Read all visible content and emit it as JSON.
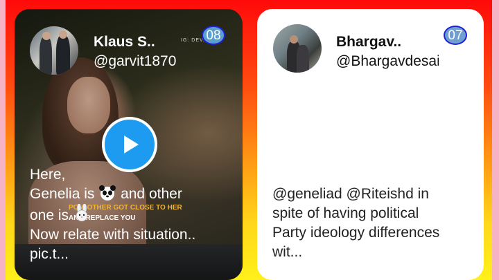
{
  "cards": [
    {
      "name": "Klaus S..",
      "handle": "@garvit1870",
      "badge": "08",
      "watermark": "IG: DEV...",
      "overlay_caption": [
        "POV: OTHER GOT CLOSE TO HER",
        "AND REPLACE YOU"
      ],
      "text": {
        "line1": "Here,",
        "line2_before": "Genelia is",
        "line2_emoji": "panda-emoji",
        "line2_after": "and other",
        "line3_before": "one is",
        "line3_emoji": "rabbit-emoji",
        "line4": "Now relate with situation..",
        "line5": "pic.t..."
      }
    },
    {
      "name": "Bhargav..",
      "handle": "@Bhargavdesai",
      "badge": "07",
      "text": {
        "line1": "@geneliad @Riteishd in",
        "line2": "spite of having political",
        "line3": "Party ideology differences",
        "line4": "wit..."
      }
    }
  ],
  "colors": {
    "play_button": "#1d9bf0",
    "badge_border": "#1f1fd6",
    "background_top": "#ff0a0a",
    "background_bottom": "#fff01a",
    "edge": "#f6b3c6"
  },
  "icons": {
    "play": "play-icon"
  }
}
